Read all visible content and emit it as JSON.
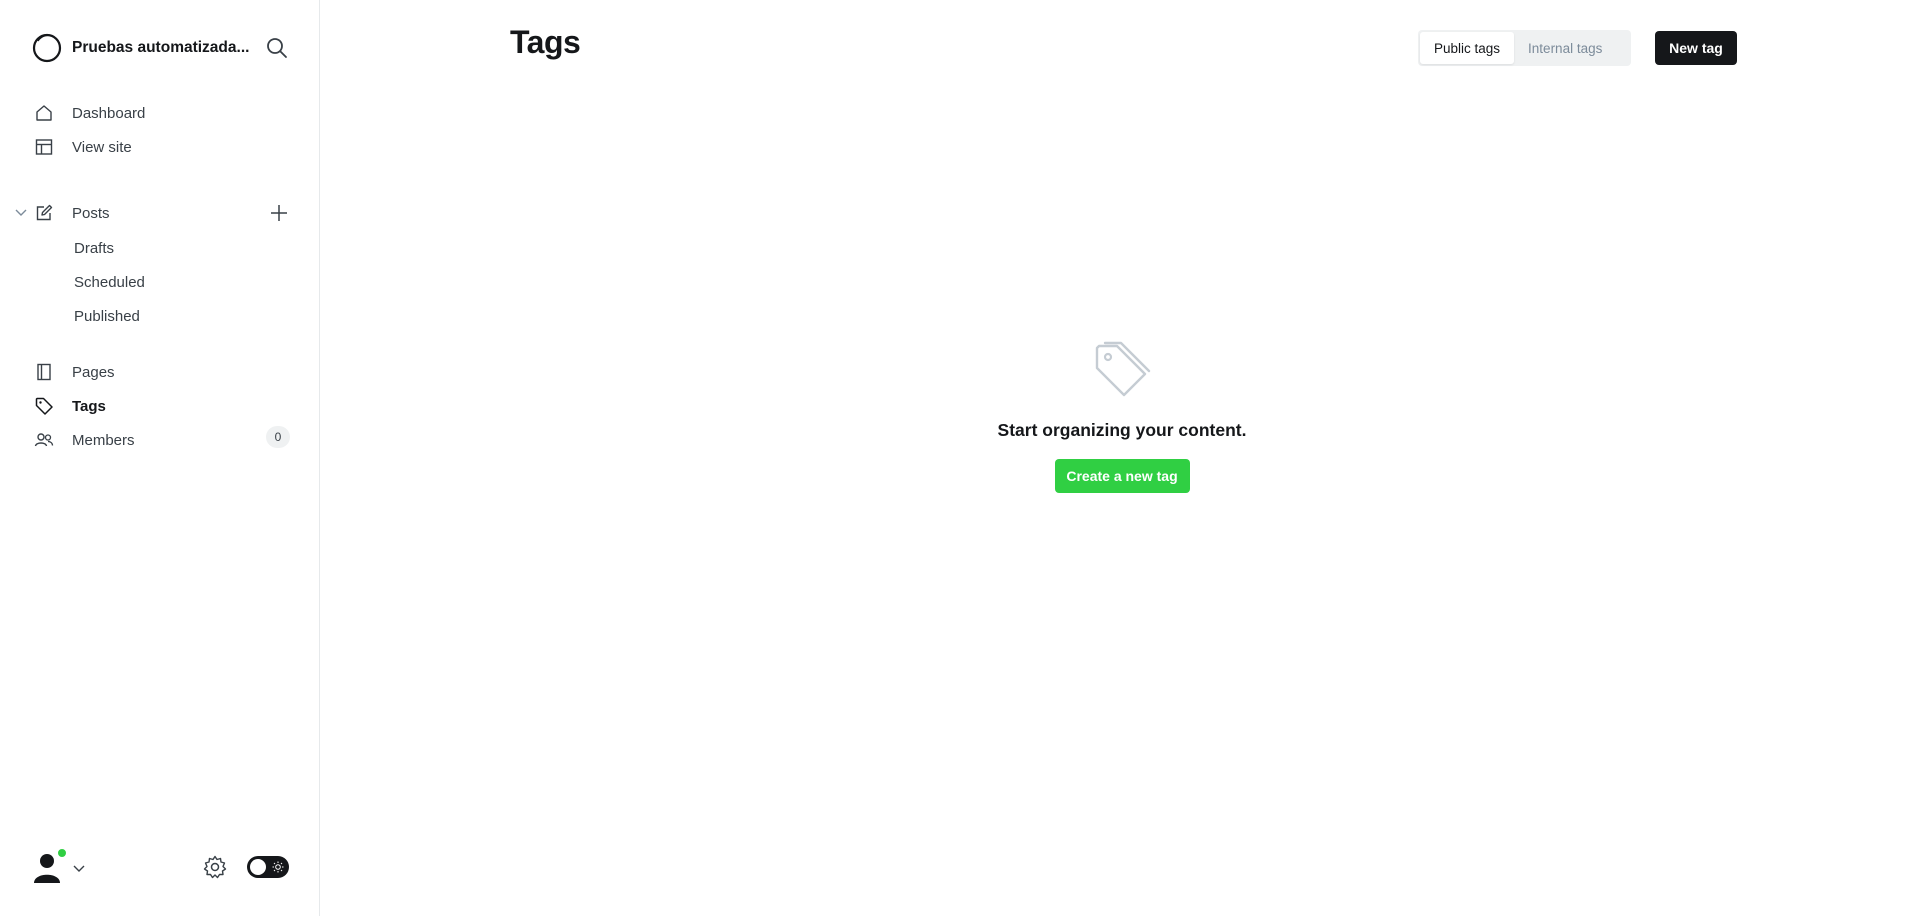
{
  "sidebar": {
    "site_title": "Pruebas automatizada...",
    "nav": {
      "dashboard": "Dashboard",
      "view_site": "View site",
      "posts": "Posts",
      "drafts": "Drafts",
      "scheduled": "Scheduled",
      "published": "Published",
      "pages": "Pages",
      "tags": "Tags",
      "members": "Members",
      "members_count": "0"
    },
    "active_item": "tags"
  },
  "header": {
    "title": "Tags",
    "filter": {
      "public": "Public tags",
      "internal": "Internal tags",
      "selected": "public"
    },
    "new_tag_label": "New tag"
  },
  "empty_state": {
    "message": "Start organizing your content.",
    "cta_label": "Create a new tag",
    "icon": "tag-icon"
  },
  "colors": {
    "accent_green": "#30cf43",
    "primary_dark": "#15171a",
    "online_dot": "#30cf43"
  }
}
